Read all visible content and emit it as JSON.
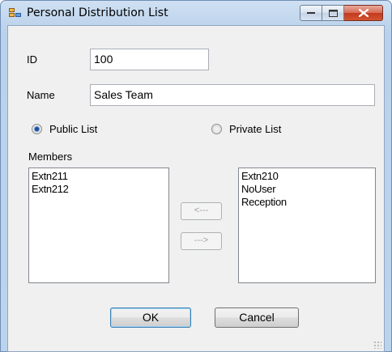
{
  "window": {
    "title": "Personal Distribution List"
  },
  "form": {
    "id_label": "ID",
    "id_value": "100",
    "name_label": "Name",
    "name_value": "Sales Team",
    "public_label": "Public List",
    "private_label": "Private List",
    "selected_list_type": "public",
    "members_label": "Members"
  },
  "members": [
    "Extn211",
    "Extn212"
  ],
  "available": [
    "Extn210",
    "NoUser",
    "Reception"
  ],
  "transfer": {
    "add_label": "<---",
    "remove_label": "--->"
  },
  "actions": {
    "ok_label": "OK",
    "cancel_label": "Cancel"
  },
  "colors": {
    "title_bar": "#b9d1ea",
    "client": "#f0f0f0",
    "close_button": "#c4381d",
    "radio_dot": "#1c4f9c",
    "default_button_border": "#3c7fb1"
  }
}
